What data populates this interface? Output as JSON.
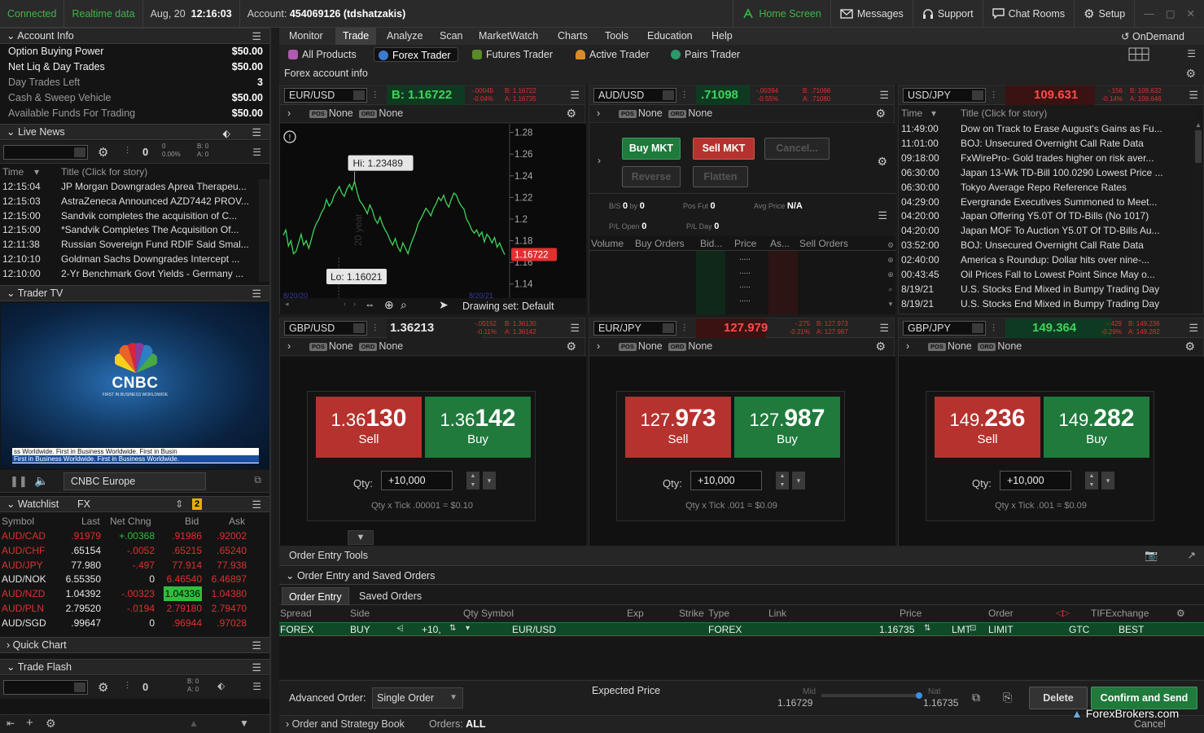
{
  "topbar": {
    "connected": "Connected",
    "realtime": "Realtime data",
    "date": "Aug, 20",
    "time": "12:16:03",
    "account_label": "Account:",
    "account_value": "454069126 (tdshatzakis)",
    "home": "Home Screen",
    "messages": "Messages",
    "support": "Support",
    "chat": "Chat Rooms",
    "setup": "Setup",
    "ondemand": "OnDemand"
  },
  "account_info": {
    "title": "Account Info",
    "rows": [
      {
        "label": "Option Buying Power",
        "value": "$50.00"
      },
      {
        "label": "Net Liq & Day Trades",
        "value": "$50.00"
      },
      {
        "label": "Day Trades Left",
        "value": "3"
      },
      {
        "label": "Cash & Sweep Vehicle",
        "value": "$50.00"
      },
      {
        "label": "Available Funds For Trading",
        "value": "$50.00"
      }
    ]
  },
  "live_news": {
    "title": "Live News",
    "count": "0",
    "pct1": "0",
    "pct2": "0.00%",
    "b": "B: 0",
    "a": "A: 0",
    "col_time": "Time",
    "col_title": "Title (Click for story)",
    "items": [
      {
        "t": "12:15:04",
        "s": "JP Morgan Downgrades Aprea Therapeu..."
      },
      {
        "t": "12:15:03",
        "s": "AstraZeneca Announced AZD7442 PROV..."
      },
      {
        "t": "12:15:00",
        "s": "Sandvik completes the acquisition of C..."
      },
      {
        "t": "12:15:00",
        "s": "*Sandvik Completes The Acquisition Of..."
      },
      {
        "t": "12:11:38",
        "s": "Russian Sovereign Fund RDIF Said Smal..."
      },
      {
        "t": "12:10:10",
        "s": "Goldman Sachs Downgrades Intercept ..."
      },
      {
        "t": "12:10:00",
        "s": "2-Yr Benchmark Govt Yields - Germany ..."
      }
    ]
  },
  "trader_tv": {
    "title": "Trader TV",
    "logo": "CNBC",
    "tagline": "FIRST IN BUSINESS WORLDWIDE",
    "ticker1": "ss Worldwide.  First in Business Worldwide.  First in Busin",
    "ticker2": "First in Business Worldwide.  First in Business Worldwide.",
    "channel": "CNBC Europe"
  },
  "watchlist": {
    "title": "Watchlist",
    "list": "FX",
    "badge": "2",
    "cols": [
      "Symbol",
      "Last",
      "Net Chng",
      "Bid",
      "Ask"
    ],
    "rows": [
      {
        "sym": "AUD/CAD",
        "last": ".91979",
        "chg": "+.00368",
        "bid": ".91986",
        "ask": ".92002",
        "symc": "red",
        "lastc": "red",
        "chgc": "grn",
        "bidc": "red",
        "askc": "red"
      },
      {
        "sym": "AUD/CHF",
        "last": ".65154",
        "chg": "-.0052",
        "bid": ".65215",
        "ask": ".65240",
        "symc": "red",
        "lastc": "white",
        "chgc": "red",
        "bidc": "red",
        "askc": "red"
      },
      {
        "sym": "AUD/JPY",
        "last": "77.980",
        "chg": "-.497",
        "bid": "77.914",
        "ask": "77.938",
        "symc": "red",
        "lastc": "white",
        "chgc": "red",
        "bidc": "red",
        "askc": "red"
      },
      {
        "sym": "AUD/NOK",
        "last": "6.55350",
        "chg": "0",
        "bid": "6.46540",
        "ask": "6.46897",
        "symc": "white",
        "lastc": "white",
        "chgc": "white",
        "bidc": "red",
        "askc": "red"
      },
      {
        "sym": "AUD/NZD",
        "last": "1.04392",
        "chg": "-.00323",
        "bid": "1.04336",
        "ask": "1.04380",
        "symc": "red",
        "lastc": "white",
        "chgc": "red",
        "bidc": "grnbg",
        "askc": "red"
      },
      {
        "sym": "AUD/PLN",
        "last": "2.79520",
        "chg": "-.0194",
        "bid": "2.79180",
        "ask": "2.79470",
        "symc": "red",
        "lastc": "white",
        "chgc": "red",
        "bidc": "red",
        "askc": "red"
      },
      {
        "sym": "AUD/SGD",
        "last": ".99647",
        "chg": "0",
        "bid": ".96944",
        "ask": ".97028",
        "symc": "white",
        "lastc": "white",
        "chgc": "white",
        "bidc": "red",
        "askc": "red"
      }
    ]
  },
  "quick_chart": "Quick Chart",
  "trade_flash": {
    "title": "Trade Flash",
    "count": "0",
    "b": "B: 0",
    "a": "A: 0"
  },
  "menu": [
    "Monitor",
    "Trade",
    "Analyze",
    "Scan",
    "MarketWatch",
    "Charts",
    "Tools",
    "Education",
    "Help"
  ],
  "submenu": [
    "All Products",
    "Forex Trader",
    "Futures Trader",
    "Active Trader",
    "Pairs Trader"
  ],
  "forex_account_info": "Forex account info",
  "pos_label": "POS",
  "ord_label": "ORD",
  "none": "None",
  "eurusd": {
    "symbol": "EUR/USD",
    "price": "B: 1.16722",
    "chg1": "-.00045",
    "chg2": "-0.04%",
    "b": "B: 1.16722",
    "a": "A: 1.16735",
    "hi": "Hi: 1.23489",
    "lo": "Lo: 1.16021",
    "cur": "1.16722",
    "ylabels": [
      "1.28",
      "1.26",
      "1.24",
      "1.22",
      "1.2",
      "1.18",
      "1.16",
      "1.14"
    ],
    "xdate1": "8/20/20",
    "xdate2": "8/20/21",
    "drawing": "Drawing set: Default",
    "watermark": "20 year"
  },
  "audusd": {
    "symbol": "AUD/USD",
    "price": ".71098",
    "chg1": "-.00394",
    "chg2": "-0.55%",
    "b": "B: .71066",
    "a": "A: .71080",
    "buy_mkt": "Buy MKT",
    "sell_mkt": "Sell MKT",
    "cancel": "Cancel...",
    "reverse": "Reverse",
    "flatten": "Flatten",
    "bs": "B/S",
    "bs_v": "0",
    "by": "by",
    "by_v": "0",
    "posfut": "Pos Fut",
    "posfut_v": "0",
    "avg": "Avg Price",
    "avg_v": "N/A",
    "plopen": "P/L Open",
    "plopen_v": "0",
    "plday": "P/L Day",
    "plday_v": "0",
    "cols": [
      "Volume",
      "Buy Orders",
      "Bid...",
      "Price",
      "As...",
      "Sell Orders"
    ],
    "dots": "....."
  },
  "usdjpy": {
    "symbol": "USD/JPY",
    "price": "109.631",
    "chg1": "-.156",
    "chg2": "-0.14%",
    "b": "B: 109.632",
    "a": "A: 109.646",
    "col_time": "Time",
    "col_title": "Title (Click for story)",
    "items": [
      {
        "t": "11:49:00",
        "s": "Dow on Track to Erase August's Gains as Fu..."
      },
      {
        "t": "11:01:00",
        "s": "BOJ: Unsecured Overnight Call Rate Data"
      },
      {
        "t": "09:18:00",
        "s": "FxWirePro- Gold trades higher on risk aver..."
      },
      {
        "t": "06:30:00",
        "s": "Japan 13-Wk TD-Bill 100.0290 Lowest Price ..."
      },
      {
        "t": "06:30:00",
        "s": "Tokyo Average Repo Reference Rates"
      },
      {
        "t": "04:29:00",
        "s": "Evergrande Executives Summoned to Meet..."
      },
      {
        "t": "04:20:00",
        "s": "Japan Offering Y5.0T Of TD-Bills (No 1017)"
      },
      {
        "t": "04:20:00",
        "s": "Japan MOF To Auction Y5.0T Of TD-Bills Au..."
      },
      {
        "t": "03:52:00",
        "s": "BOJ: Unsecured Overnight Call Rate Data"
      },
      {
        "t": "02:40:00",
        "s": "America    s Roundup: Dollar hits over nine-..."
      },
      {
        "t": "00:43:45",
        "s": "Oil Prices Fall to Lowest Point Since May o..."
      },
      {
        "t": "8/19/21",
        "s": "U.S. Stocks End Mixed in Bumpy Trading Day"
      },
      {
        "t": "8/19/21",
        "s": "U.S. Stocks End Mixed in Bumpy Trading Day"
      }
    ]
  },
  "gbpusd": {
    "symbol": "GBP/USD",
    "price": "1.36213",
    "chg1": "-.00152",
    "chg2": "-0.11%",
    "b": "B: 1.36130",
    "a": "A: 1.36142",
    "sell_a": "1.36",
    "sell_b": "130",
    "buy_a": "1.36",
    "buy_b": "142",
    "sell": "Sell",
    "buy": "Buy",
    "qty_label": "Qty:",
    "qty": "+10,000",
    "tick": "Qty x Tick .00001 = $0.10"
  },
  "eurjpy": {
    "symbol": "EUR/JPY",
    "price": "127.979",
    "chg1": "-.275",
    "chg2": "-0.21%",
    "b": "B: 127.973",
    "a": "A: 127.987",
    "sell_a": "127.",
    "sell_b": "973",
    "buy_a": "127.",
    "buy_b": "987",
    "sell": "Sell",
    "buy": "Buy",
    "qty_label": "Qty:",
    "qty": "+10,000",
    "tick": "Qty x Tick .001 = $0.09"
  },
  "gbpjpy": {
    "symbol": "GBP/JPY",
    "price": "149.364",
    "chg1": "-.429",
    "chg2": "-0.29%",
    "b": "B: 149.236",
    "a": "A: 149.282",
    "sell_a": "149.",
    "sell_b": "236",
    "buy_a": "149.",
    "buy_b": "282",
    "sell": "Sell",
    "buy": "Buy",
    "qty_label": "Qty:",
    "qty": "+10,000",
    "tick": "Qty x Tick .001 = $0.09"
  },
  "order_entry": {
    "tools": "Order Entry Tools",
    "section": "Order Entry and Saved Orders",
    "tab1": "Order Entry",
    "tab2": "Saved Orders",
    "cols": [
      "Spread",
      "Side",
      "Qty",
      "Symbol",
      "Exp",
      "Strike",
      "Type",
      "Link",
      "Price",
      "Order",
      "TIF",
      "Exchange"
    ],
    "row": {
      "spread": "FOREX",
      "side": "BUY",
      "qty": "+10,",
      "symbol": "EUR/USD",
      "type": "FOREX",
      "price": "1.16735",
      "lmt": "LMT",
      "order": "LIMIT",
      "tif": "GTC",
      "exchange": "BEST"
    },
    "advanced_label": "Advanced Order:",
    "advanced_value": "Single Order",
    "expected": "Expected  Price",
    "mid": "Mid",
    "mid_v": "1.16729",
    "nat": "Nat",
    "nat_v": "1.16735",
    "delete": "Delete",
    "confirm": "Confirm and Send",
    "cancel": "Cancel",
    "book": "Order and Strategy Book",
    "orders_label": "Orders:",
    "orders_value": "ALL"
  },
  "watermark": "ForexBrokers.com",
  "colors": {
    "sell": "#b5322e",
    "buy": "#1f7a3c",
    "green_text": "#3fb54a",
    "red_text": "#e03030"
  }
}
